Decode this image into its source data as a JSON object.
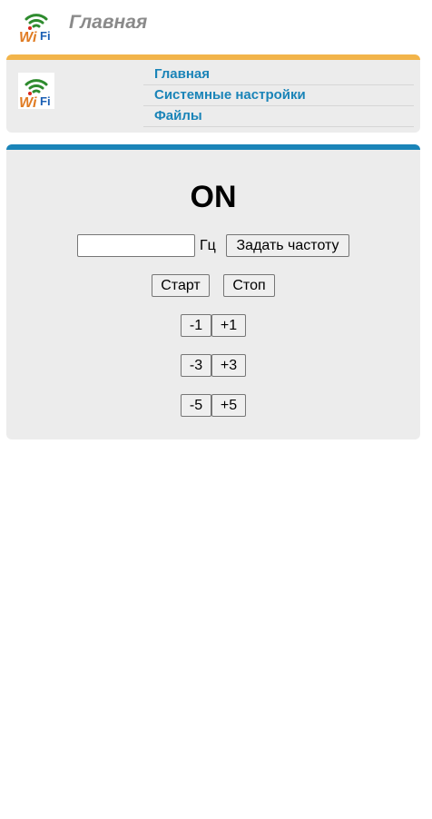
{
  "header": {
    "title": "Главная",
    "logo_icon": "wifi-logo-icon"
  },
  "nav": {
    "logo_icon": "wifi-logo-icon",
    "items": [
      {
        "label": "Главная"
      },
      {
        "label": "Системные настройки"
      },
      {
        "label": "Файлы"
      }
    ]
  },
  "control": {
    "state": "ON",
    "frequency": {
      "value": "",
      "placeholder": "",
      "unit": "Гц",
      "set_label": "Задать частоту"
    },
    "start_label": "Старт",
    "stop_label": "Стоп",
    "steps": [
      {
        "minus": "-1",
        "plus": "+1"
      },
      {
        "minus": "-3",
        "plus": "+3"
      },
      {
        "minus": "-5",
        "plus": "+5"
      }
    ]
  },
  "colors": {
    "nav_accent": "#f2b44a",
    "control_accent": "#1a84b8",
    "link": "#1a84b8",
    "card_bg": "#ececec",
    "header_title": "#8a8a8a",
    "wifi_green": "#2e8b2e",
    "wifi_red": "#d9261c",
    "wifi_orange": "#e07b22"
  }
}
